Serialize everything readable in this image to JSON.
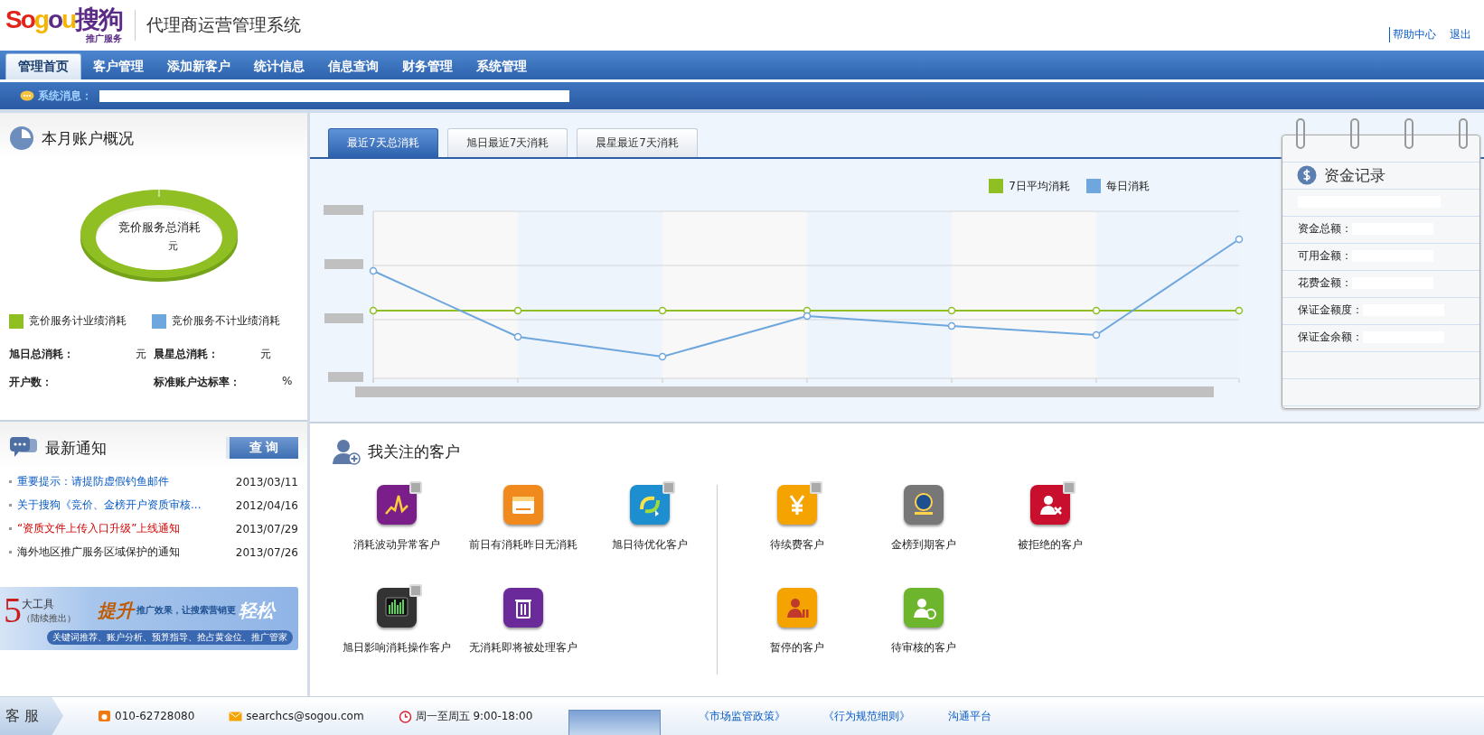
{
  "logo": {
    "letters": [
      "S",
      "o",
      "g",
      "o",
      "u",
      "搜狗"
    ],
    "subtitle": "推广服务"
  },
  "app_title": "代理商运营管理系统",
  "top_links": [
    "帮助中心",
    "退出"
  ],
  "nav_tabs": [
    {
      "label": "管理首页",
      "selected": true
    },
    {
      "label": "客户管理",
      "selected": false
    },
    {
      "label": "添加新客户",
      "selected": false
    },
    {
      "label": "统计信息",
      "selected": false
    },
    {
      "label": "信息查询",
      "selected": false
    },
    {
      "label": "财务管理",
      "selected": false
    },
    {
      "label": "系统管理",
      "selected": false
    }
  ],
  "system_message": {
    "label": "系统消息："
  },
  "overview": {
    "title": "本月账户概况",
    "donut_label": "竞价服务总消耗",
    "donut_unit": "元",
    "legend": [
      {
        "label": "竞价服务计业绩消耗",
        "color": "#8fbf22"
      },
      {
        "label": "竞价服务不计业绩消耗",
        "color": "#6ea7dd"
      }
    ],
    "stats": [
      [
        {
          "label": "旭日总消耗：",
          "unit": "元"
        },
        {
          "label": "晨星总消耗：",
          "unit": "元"
        }
      ],
      [
        {
          "label": "开户数："
        },
        {
          "label": "标准账户达标率：",
          "unit": "%"
        }
      ]
    ]
  },
  "notices": {
    "title": "最新通知",
    "search_button": "查 询",
    "items": [
      {
        "text": "重要提示：请提防虚假钓鱼邮件",
        "date": "2013/03/11",
        "kind": "link"
      },
      {
        "text": "关于搜狗《竞价、金榜开户资质审核...",
        "date": "2012/04/16",
        "kind": "link"
      },
      {
        "text": "“资质文件上传入口升级”上线通知",
        "date": "2013/07/29",
        "kind": "alert"
      },
      {
        "text": "海外地区推广服务区域保护的通知",
        "date": "2013/07/26",
        "kind": "plain"
      }
    ]
  },
  "banner": {
    "number": "5",
    "tools": "大工具",
    "soon": "（陆续推出）",
    "lift": "提升",
    "slogan": "推广效果，让搜索营销更",
    "easy": "轻松",
    "features": "关键词推荐、账户分析、预算指导、抢占黄金位、推广管家"
  },
  "chart_tabs": [
    {
      "label": "最近7天总消耗",
      "selected": true
    },
    {
      "label": "旭日最近7天消耗",
      "selected": false
    },
    {
      "label": "晨星最近7天消耗",
      "selected": false
    }
  ],
  "chart_legend": [
    {
      "label": "7日平均消耗",
      "color": "#8fbf22"
    },
    {
      "label": "每日消耗",
      "color": "#6ea7dd"
    }
  ],
  "funds": {
    "title": "资金记录",
    "rows": [
      "资金总额：",
      "可用金额：",
      "花费金额：",
      "保证金额度：",
      "保证金余额："
    ]
  },
  "watched": {
    "title": "我关注的客户",
    "groups": [
      [
        {
          "label": "消耗波动异常客户",
          "kind": "chart",
          "color": "#7a1f8a",
          "marked": true
        },
        {
          "label": "前日有消耗昨日无消耗",
          "kind": "calendar",
          "color": "#f08a1c",
          "marked": false
        },
        {
          "label": "旭日待优化客户",
          "kind": "refresh",
          "color": "#1d8fd0",
          "marked": true
        },
        {
          "label": "旭日影响消耗操作客户",
          "kind": "monitor",
          "color": "#333333",
          "marked": true
        },
        {
          "label": "无消耗即将被处理客户",
          "kind": "trash",
          "color": "#6a2a9a",
          "marked": false
        }
      ],
      [
        {
          "label": "待续费客户",
          "kind": "yen",
          "color": "#f5a300",
          "marked": true
        },
        {
          "label": "金榜到期客户",
          "kind": "medal",
          "color": "#777777",
          "marked": false
        },
        {
          "label": "被拒绝的客户",
          "kind": "reject",
          "color": "#c8102e",
          "marked": true
        },
        {
          "label": "暂停的客户",
          "kind": "pause",
          "color": "#f5a300",
          "marked": false
        },
        {
          "label": "待审核的客户",
          "kind": "approve",
          "color": "#6cb52d",
          "marked": false
        }
      ]
    ]
  },
  "footer": {
    "label": "客 服",
    "phone": "010-62728080",
    "email": "searchcs@sogou.com",
    "hours": "周一至周五 9:00-18:00",
    "links": [
      "《市场监管政策》",
      "《行为规范细则》",
      "沟通平台"
    ]
  }
}
